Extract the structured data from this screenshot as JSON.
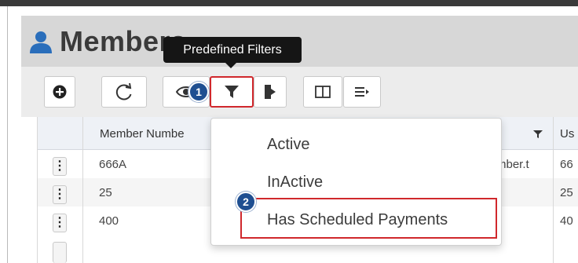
{
  "page": {
    "title": "Members"
  },
  "tooltip": {
    "text": "Predefined Filters"
  },
  "toolbar": {
    "buttons": [
      {
        "icon": "plus-circle-icon"
      },
      {
        "icon": "refresh-icon"
      },
      {
        "icon": "eye-icon"
      },
      {
        "icon": "filter-icon"
      },
      {
        "icon": "export-icon"
      },
      {
        "icon": "columns-icon"
      },
      {
        "icon": "list-icon"
      }
    ]
  },
  "annotations": {
    "step1": "1",
    "step2": "2"
  },
  "table": {
    "headers": [
      "Member Numbe",
      "Us"
    ],
    "rows": [
      {
        "menu": "⋮",
        "member_number": "666A",
        "middle": "mber.t",
        "right": "66"
      },
      {
        "menu": "⋮",
        "member_number": "25",
        "middle": "",
        "right": "25"
      },
      {
        "menu": "⋮",
        "member_number": "400",
        "middle": "",
        "right": "40"
      }
    ]
  },
  "filter_menu": {
    "items": [
      "Active",
      "InActive",
      "Has Scheduled Payments"
    ],
    "highlighted": "Has Scheduled Payments"
  },
  "colors": {
    "accent_blue": "#2a6ebb",
    "badge": "#1f4f91",
    "highlight_red": "#d0282c",
    "tooltip_bg": "#151515"
  }
}
